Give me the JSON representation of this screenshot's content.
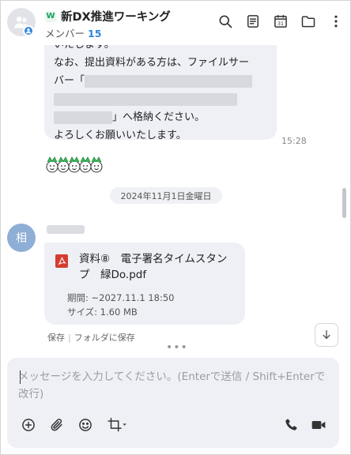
{
  "header": {
    "room_title": "新DX推進ワーキング",
    "logo_letter": "W",
    "members_label": "メンバー",
    "member_count": "15",
    "icons": [
      "search-icon",
      "notes-icon",
      "calendar-icon",
      "folder-icon",
      "more-icon"
    ],
    "calendar_day": "31"
  },
  "previous_message": {
    "lines": [
      "いたします。",
      "なお、提出資料がある方は、ファイルサー",
      "バー「",
      "」へ格納ください。",
      "よろしくお願いいたします。"
    ],
    "time": "15:28"
  },
  "date_divider": "2024年11月1日金曜日",
  "sender": {
    "avatar_initial": "相"
  },
  "file_message": {
    "file_name": "資料⑧　電子署名タイムスタンプ　緑Do.pdf",
    "expiry": "期間: ~2027.11.1 18:50",
    "size": "サイズ: 1.60 MB",
    "save_label": "保存",
    "separator": "|",
    "save_to_folder_label": "フォルダに保存"
  },
  "more_indicator": "•••",
  "composer": {
    "placeholder": "メッセージを入力してください。(Enterで送信 / Shift+Enterで改行)",
    "tools_left": [
      "add-icon",
      "attach-icon",
      "emoji-icon",
      "crop-icon"
    ],
    "tools_right": [
      "phone-icon",
      "video-icon"
    ]
  },
  "colors": {
    "accent": "#2f86e0",
    "bubble": "#eef0f5",
    "pdf_red": "#d53c2f",
    "avatar_blue": "#8faed6"
  }
}
